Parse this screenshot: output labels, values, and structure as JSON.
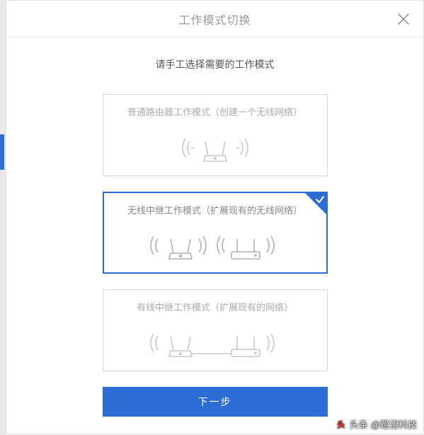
{
  "modal": {
    "title": "工作模式切换",
    "subtitle": "请手工选择需要的工作模式",
    "options": [
      {
        "label": "普通路由器工作模式（创建一个无线网络）",
        "selected": false
      },
      {
        "label": "无线中继工作模式（扩展现有的无线网络）",
        "selected": true
      },
      {
        "label": "有线中继工作模式（扩展现有的网络）",
        "selected": false
      }
    ],
    "next_button": "下一步"
  },
  "watermark": {
    "prefix": "头条",
    "author": "@蹬沼科技"
  },
  "icons": {
    "close": "close-icon",
    "check": "check-icon",
    "router": "router-icon",
    "waves": "signal-waves-icon"
  }
}
